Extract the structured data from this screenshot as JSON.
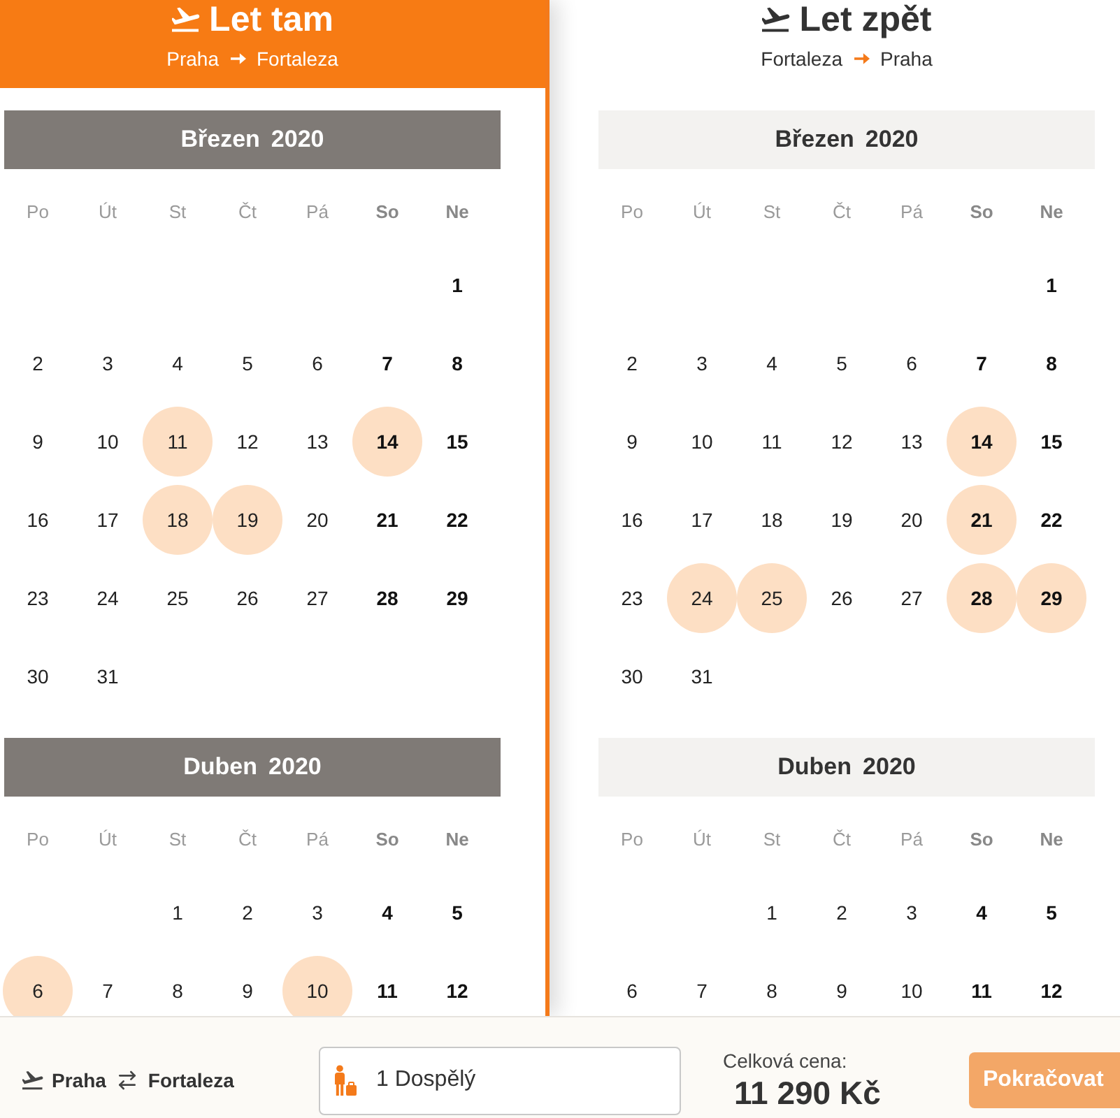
{
  "panels": [
    {
      "title": "Let tam",
      "from": "Praha",
      "to": "Fortaleza",
      "selected": true,
      "months": [
        {
          "month": "Březen",
          "year": "2020",
          "weekdays": [
            {
              "label": "Po",
              "weekend": false
            },
            {
              "label": "Út",
              "weekend": false
            },
            {
              "label": "St",
              "weekend": false
            },
            {
              "label": "Čt",
              "weekend": false
            },
            {
              "label": "Pá",
              "weekend": false
            },
            {
              "label": "So",
              "weekend": true
            },
            {
              "label": "Ne",
              "weekend": true
            }
          ],
          "weeks": [
            {
              "kind": "first",
              "days": [
                {
                  "day": "1",
                  "available": false
                }
              ]
            },
            {
              "kind": "week",
              "days": [
                {
                  "day": "2",
                  "available": false
                },
                {
                  "day": "3",
                  "available": false
                },
                {
                  "day": "4",
                  "available": false
                },
                {
                  "day": "5",
                  "available": false
                },
                {
                  "day": "6",
                  "available": false
                },
                {
                  "day": "7",
                  "available": false
                },
                {
                  "day": "8",
                  "available": false
                }
              ]
            },
            {
              "kind": "week",
              "days": [
                {
                  "day": "9",
                  "available": false
                },
                {
                  "day": "10",
                  "available": false
                },
                {
                  "day": "11",
                  "available": true
                },
                {
                  "day": "12",
                  "available": false
                },
                {
                  "day": "13",
                  "available": false
                },
                {
                  "day": "14",
                  "available": true
                },
                {
                  "day": "15",
                  "available": false
                }
              ]
            },
            {
              "kind": "week",
              "days": [
                {
                  "day": "16",
                  "available": false
                },
                {
                  "day": "17",
                  "available": false
                },
                {
                  "day": "18",
                  "available": true
                },
                {
                  "day": "19",
                  "available": true
                },
                {
                  "day": "20",
                  "available": false
                },
                {
                  "day": "21",
                  "available": false
                },
                {
                  "day": "22",
                  "available": false
                }
              ]
            },
            {
              "kind": "week",
              "days": [
                {
                  "day": "23",
                  "available": false
                },
                {
                  "day": "24",
                  "available": false
                },
                {
                  "day": "25",
                  "available": false
                },
                {
                  "day": "26",
                  "available": false
                },
                {
                  "day": "27",
                  "available": false
                },
                {
                  "day": "28",
                  "available": false
                },
                {
                  "day": "29",
                  "available": false
                }
              ]
            },
            {
              "kind": "week",
              "days": [
                {
                  "day": "30",
                  "available": false
                },
                {
                  "day": "31",
                  "available": false
                }
              ]
            }
          ]
        },
        {
          "month": "Duben",
          "year": "2020",
          "weekdays": [
            {
              "label": "Po",
              "weekend": false
            },
            {
              "label": "Út",
              "weekend": false
            },
            {
              "label": "St",
              "weekend": false
            },
            {
              "label": "Čt",
              "weekend": false
            },
            {
              "label": "Pá",
              "weekend": false
            },
            {
              "label": "So",
              "weekend": true
            },
            {
              "label": "Ne",
              "weekend": true
            }
          ],
          "weeks": [
            {
              "kind": "first",
              "days": [
                {
                  "day": "1",
                  "available": false
                },
                {
                  "day": "2",
                  "available": false
                },
                {
                  "day": "3",
                  "available": false
                },
                {
                  "day": "4",
                  "available": false
                },
                {
                  "day": "5",
                  "available": false
                }
              ]
            },
            {
              "kind": "week",
              "days": [
                {
                  "day": "6",
                  "available": true
                },
                {
                  "day": "7",
                  "available": false
                },
                {
                  "day": "8",
                  "available": false
                },
                {
                  "day": "9",
                  "available": false
                },
                {
                  "day": "10",
                  "available": true
                },
                {
                  "day": "11",
                  "available": false
                },
                {
                  "day": "12",
                  "available": false
                }
              ]
            }
          ]
        }
      ]
    },
    {
      "title": "Let zpět",
      "from": "Fortaleza",
      "to": "Praha",
      "selected": false,
      "months": [
        {
          "month": "Březen",
          "year": "2020",
          "weekdays": [
            {
              "label": "Po",
              "weekend": false
            },
            {
              "label": "Út",
              "weekend": false
            },
            {
              "label": "St",
              "weekend": false
            },
            {
              "label": "Čt",
              "weekend": false
            },
            {
              "label": "Pá",
              "weekend": false
            },
            {
              "label": "So",
              "weekend": true
            },
            {
              "label": "Ne",
              "weekend": true
            }
          ],
          "weeks": [
            {
              "kind": "first",
              "days": [
                {
                  "day": "1",
                  "available": false
                }
              ]
            },
            {
              "kind": "week",
              "days": [
                {
                  "day": "2",
                  "available": false
                },
                {
                  "day": "3",
                  "available": false
                },
                {
                  "day": "4",
                  "available": false
                },
                {
                  "day": "5",
                  "available": false
                },
                {
                  "day": "6",
                  "available": false
                },
                {
                  "day": "7",
                  "available": false
                },
                {
                  "day": "8",
                  "available": false
                }
              ]
            },
            {
              "kind": "week",
              "days": [
                {
                  "day": "9",
                  "available": false
                },
                {
                  "day": "10",
                  "available": false
                },
                {
                  "day": "11",
                  "available": false
                },
                {
                  "day": "12",
                  "available": false
                },
                {
                  "day": "13",
                  "available": false
                },
                {
                  "day": "14",
                  "available": true
                },
                {
                  "day": "15",
                  "available": false
                }
              ]
            },
            {
              "kind": "week",
              "days": [
                {
                  "day": "16",
                  "available": false
                },
                {
                  "day": "17",
                  "available": false
                },
                {
                  "day": "18",
                  "available": false
                },
                {
                  "day": "19",
                  "available": false
                },
                {
                  "day": "20",
                  "available": false
                },
                {
                  "day": "21",
                  "available": true
                },
                {
                  "day": "22",
                  "available": false
                }
              ]
            },
            {
              "kind": "week",
              "days": [
                {
                  "day": "23",
                  "available": false
                },
                {
                  "day": "24",
                  "available": true
                },
                {
                  "day": "25",
                  "available": true
                },
                {
                  "day": "26",
                  "available": false
                },
                {
                  "day": "27",
                  "available": false
                },
                {
                  "day": "28",
                  "available": true
                },
                {
                  "day": "29",
                  "available": true
                }
              ]
            },
            {
              "kind": "week",
              "days": [
                {
                  "day": "30",
                  "available": false
                },
                {
                  "day": "31",
                  "available": false
                }
              ]
            }
          ]
        },
        {
          "month": "Duben",
          "year": "2020",
          "weekdays": [
            {
              "label": "Po",
              "weekend": false
            },
            {
              "label": "Út",
              "weekend": false
            },
            {
              "label": "St",
              "weekend": false
            },
            {
              "label": "Čt",
              "weekend": false
            },
            {
              "label": "Pá",
              "weekend": false
            },
            {
              "label": "So",
              "weekend": true
            },
            {
              "label": "Ne",
              "weekend": true
            }
          ],
          "weeks": [
            {
              "kind": "first",
              "days": [
                {
                  "day": "1",
                  "available": false
                },
                {
                  "day": "2",
                  "available": false
                },
                {
                  "day": "3",
                  "available": false
                },
                {
                  "day": "4",
                  "available": false
                },
                {
                  "day": "5",
                  "available": false
                }
              ]
            },
            {
              "kind": "week",
              "days": [
                {
                  "day": "6",
                  "available": false
                },
                {
                  "day": "7",
                  "available": false
                },
                {
                  "day": "8",
                  "available": false
                },
                {
                  "day": "9",
                  "available": false
                },
                {
                  "day": "10",
                  "available": false
                },
                {
                  "day": "11",
                  "available": false
                },
                {
                  "day": "12",
                  "available": false
                }
              ]
            }
          ]
        }
      ]
    }
  ],
  "footer": {
    "route": {
      "from": "Praha",
      "to": "Fortaleza"
    },
    "passengers": {
      "value": "1 Dospělý"
    },
    "total": {
      "label": "Celková cena:",
      "price": "11 290 Kč"
    },
    "continue_button": {
      "label": "Pokračovat",
      "disabled": true
    }
  }
}
